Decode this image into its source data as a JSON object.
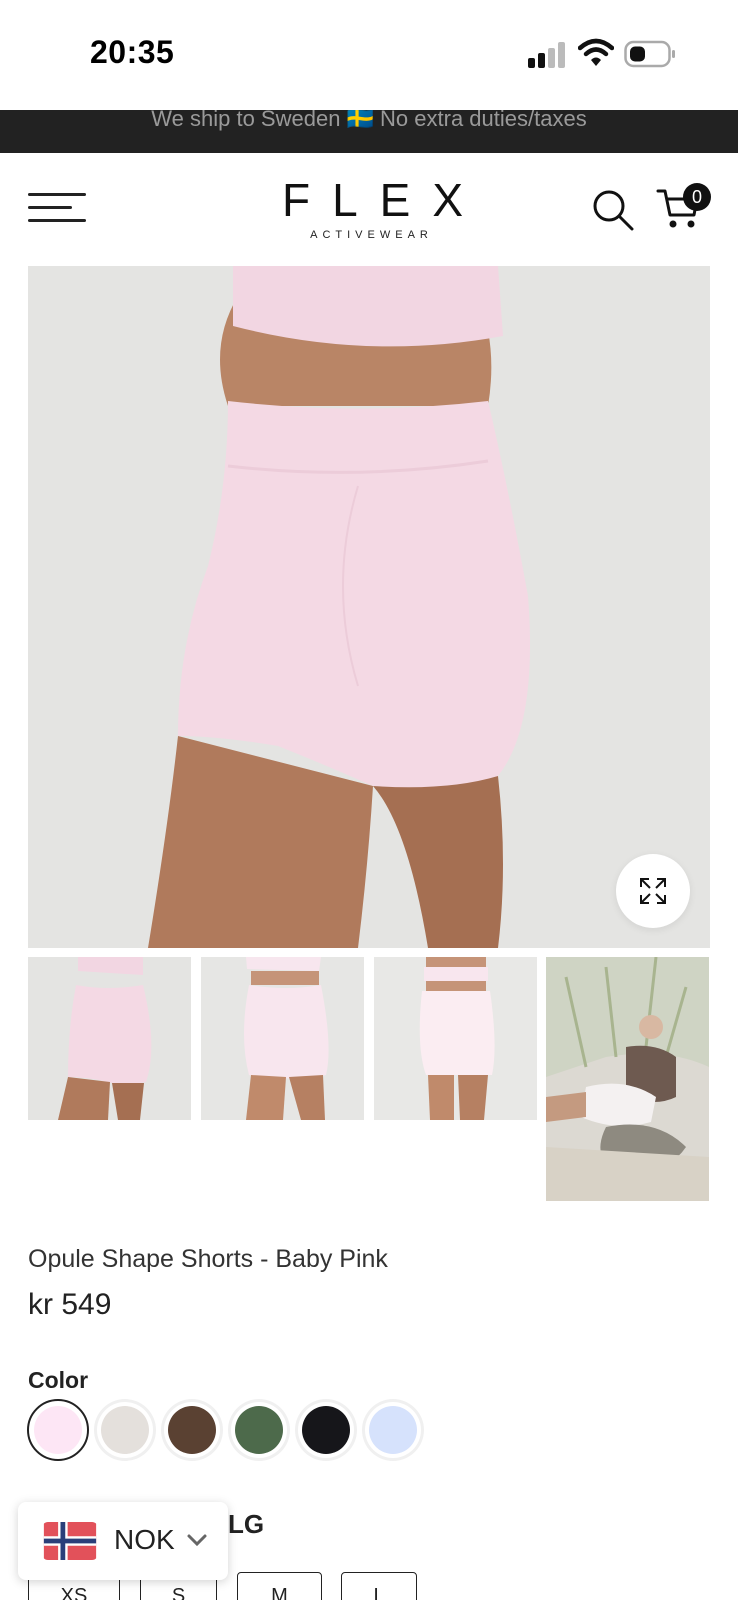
{
  "status_bar": {
    "time": "20:35"
  },
  "announcement": {
    "text": "We ship to Sweden 🇸🇪 No extra duties/taxes"
  },
  "header": {
    "logo_main": "FLEX",
    "logo_sub": "ACTIVEWEAR",
    "cart_count": "0",
    "icons": [
      "menu-icon",
      "search-icon",
      "cart-icon"
    ]
  },
  "product": {
    "title": "Opule Shape Shorts - Baby Pink",
    "price": "kr 549",
    "color_label": "Color",
    "colors": [
      {
        "name": "Baby Pink",
        "hex": "#fde6f5",
        "selected": true
      },
      {
        "name": "Light Grey",
        "hex": "#e4e0dc",
        "selected": false
      },
      {
        "name": "Brown",
        "hex": "#5a4132",
        "selected": false
      },
      {
        "name": "Green",
        "hex": "#4d6a4b",
        "selected": false
      },
      {
        "name": "Black",
        "hex": "#16161a",
        "selected": false
      },
      {
        "name": "Light Blue",
        "hex": "#d6e2fc",
        "selected": false
      }
    ],
    "size_label": "LG",
    "sizes": [
      "XS",
      "S",
      "M",
      "L"
    ]
  },
  "currency": {
    "code": "NOK"
  },
  "colors": {
    "announcement_bg": "#222222",
    "image_bg": "#e4e4e2",
    "shorts_pink": "#f4d9e4",
    "skin": "#b07a5c"
  }
}
